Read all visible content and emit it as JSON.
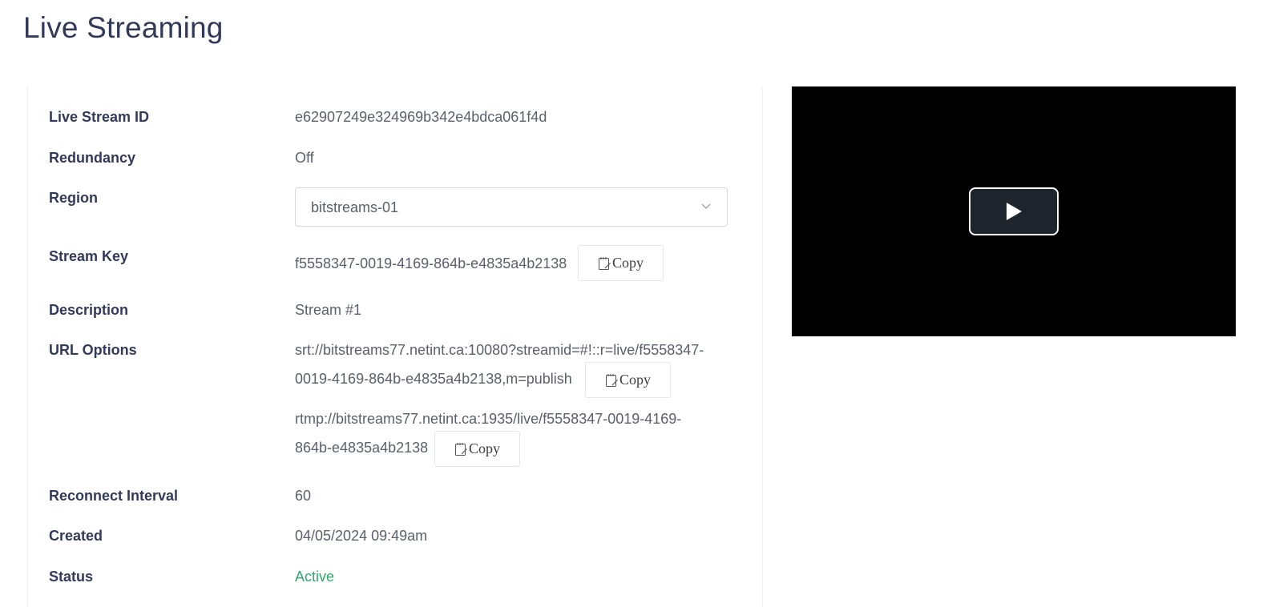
{
  "page": {
    "title": "Live Streaming"
  },
  "details": {
    "stream_id": {
      "label": "Live Stream ID",
      "value": "e62907249e324969b342e4bdca061f4d"
    },
    "redundancy": {
      "label": "Redundancy",
      "value": "Off"
    },
    "region": {
      "label": "Region",
      "selected": "bitstreams-01",
      "icon": "chevron-down-icon"
    },
    "stream_key": {
      "label": "Stream Key",
      "value": "f5558347-0019-4169-864b-e4835a4b2138",
      "copy_label": "Copy",
      "copy_icon": "clipboard-icon"
    },
    "description": {
      "label": "Description",
      "value": "Stream #1"
    },
    "url_options": {
      "label": "URL Options",
      "srt": {
        "line1": "srt://bitstreams77.netint.ca:10080?streamid=#!::r=live/f5558347-",
        "line2": "0019-4169-864b-e4835a4b2138,m=publish",
        "copy_label": "Copy"
      },
      "rtmp": {
        "line1": "rtmp://bitstreams77.netint.ca:1935/live/f5558347-0019-4169-",
        "line2": "864b-e4835a4b2138",
        "copy_label": "Copy"
      }
    },
    "reconnect_interval": {
      "label": "Reconnect Interval",
      "value": "60"
    },
    "created": {
      "label": "Created",
      "value": "04/05/2024 09:49am"
    },
    "status": {
      "label": "Status",
      "value": "Active",
      "color": "#2ea86f"
    }
  },
  "player": {
    "play_icon": "play-icon",
    "background": "#000000"
  }
}
